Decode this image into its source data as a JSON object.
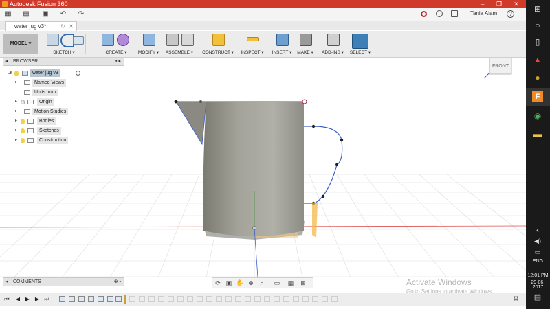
{
  "window": {
    "title": "Autodesk Fusion 360",
    "controls": [
      "–",
      "❐",
      "✕"
    ]
  },
  "qat": {
    "user": "Tania Alam",
    "help": "?"
  },
  "document_tab": {
    "label": "water jug v3*"
  },
  "ribbon": {
    "workspace": "MODEL",
    "groups": [
      "SKETCH",
      "CREATE",
      "MODIFY",
      "ASSEMBLE",
      "CONSTRUCT",
      "INSPECT",
      "INSERT",
      "MAKE",
      "ADD-INS",
      "SELECT"
    ]
  },
  "viewcube": {
    "face": "FRONT"
  },
  "browser": {
    "title": "BROWSER",
    "root": "water jug v3",
    "items": [
      "Named Views",
      "Units: mm",
      "Origin",
      "Motion Studies",
      "Bodies",
      "Sketches",
      "Construction"
    ]
  },
  "comments": {
    "title": "COMMENTS"
  },
  "watermark": {
    "line1": "Activate Windows",
    "line2": "Go to Settings to activate Windows."
  },
  "taskbar": {
    "lang": "ENG",
    "time": "12:01 PM",
    "date": "29-06-2017"
  },
  "colors": {
    "titlebar": "#d03a2a",
    "taskbar": "#1a1a1a",
    "sketch_line": "#3a5fc8",
    "body": "#9a9a92"
  }
}
